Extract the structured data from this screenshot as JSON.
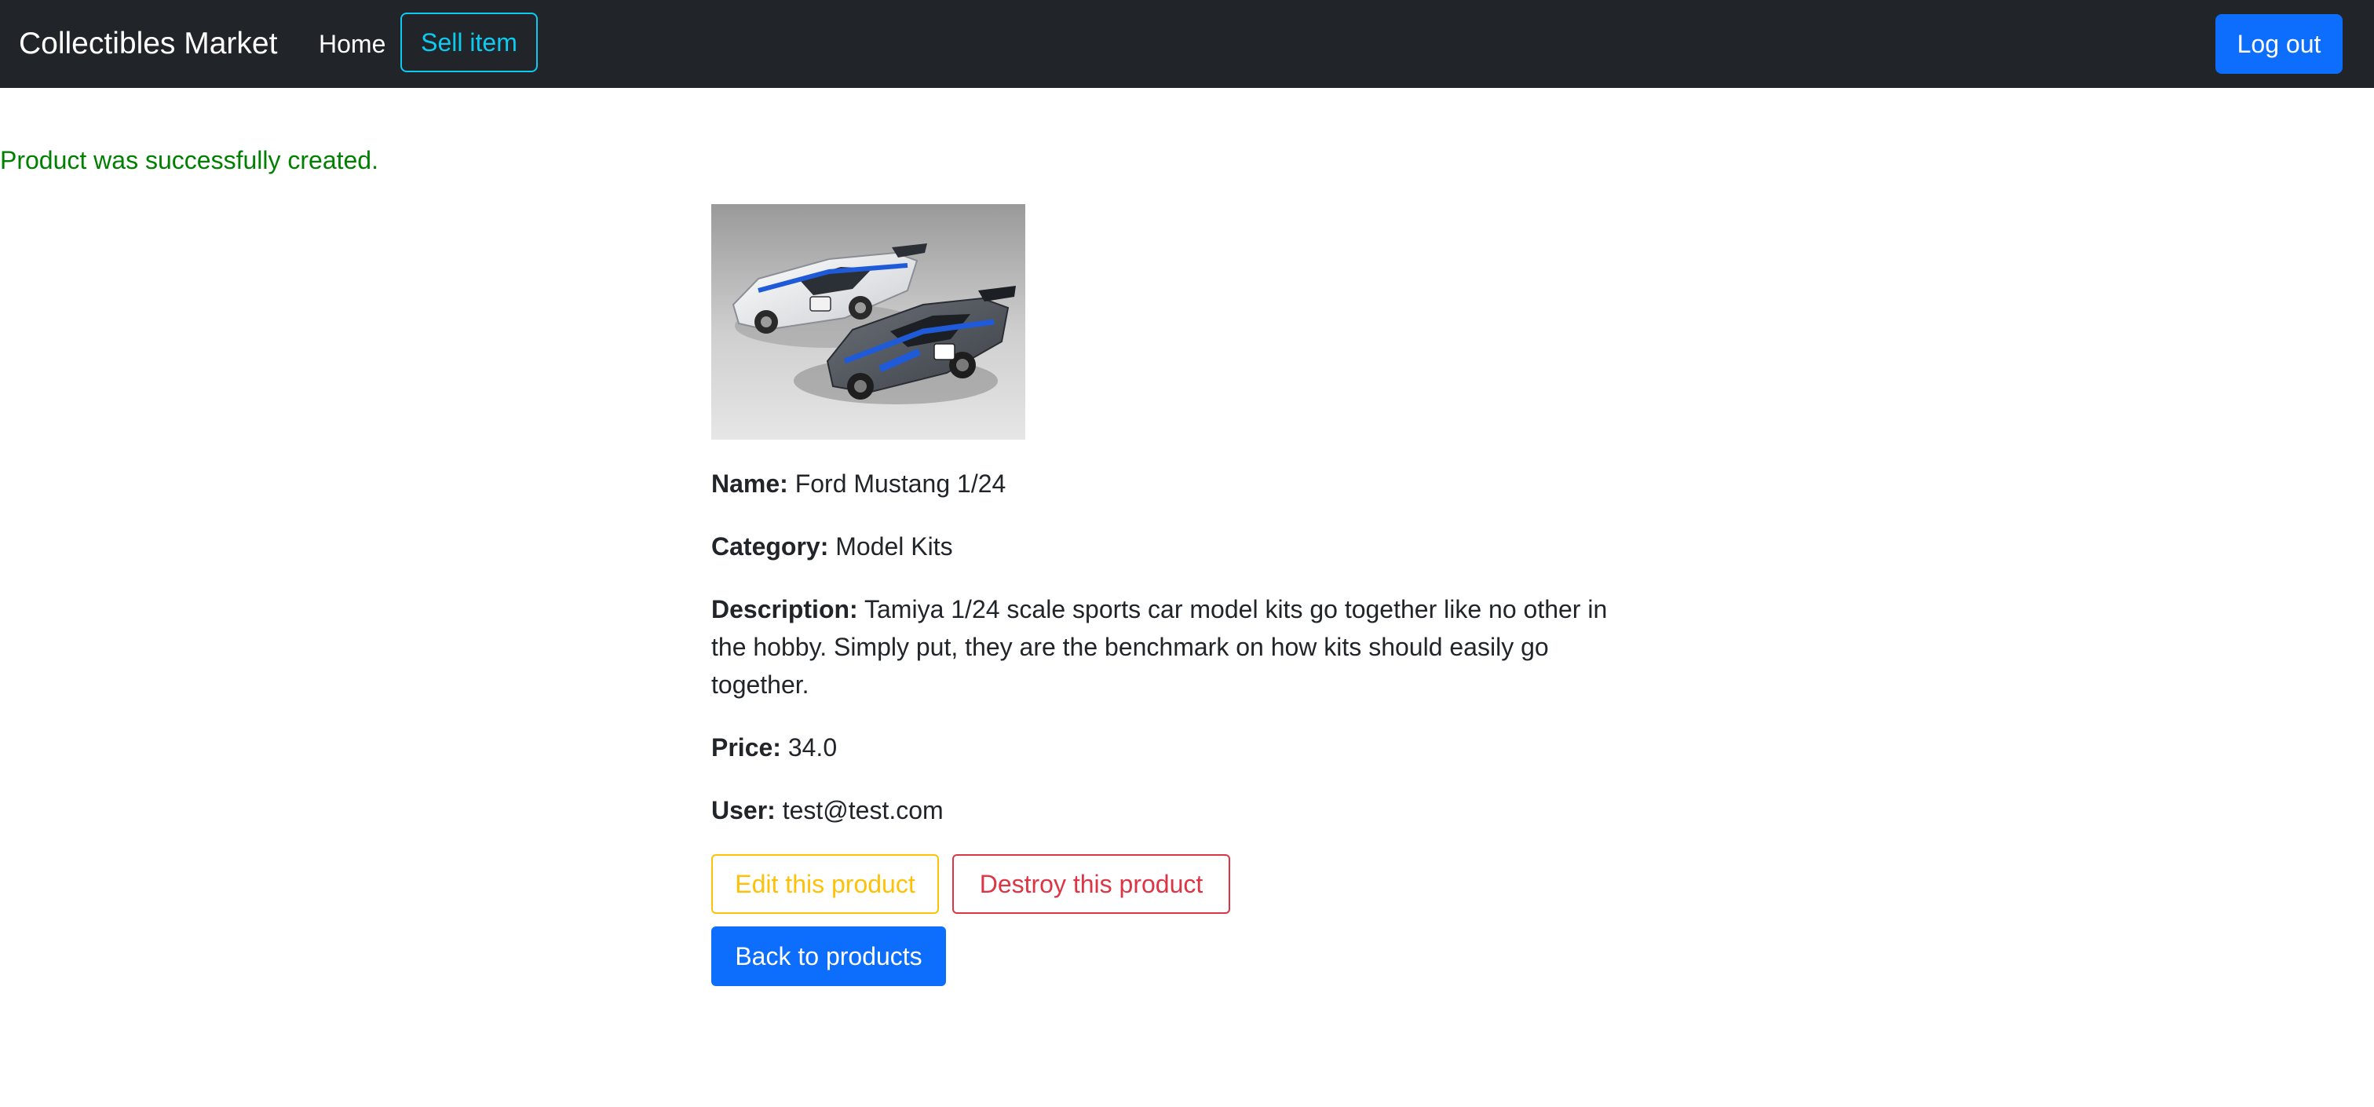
{
  "navbar": {
    "brand": "Collectibles Market",
    "home_label": "Home",
    "sell_label": "Sell item",
    "logout_label": "Log out"
  },
  "notice": "Product was successfully created.",
  "product": {
    "name_label": "Name:",
    "name": "Ford Mustang 1/24",
    "category_label": "Category:",
    "category": "Model Kits",
    "description_label": "Description:",
    "description": "Tamiya 1/24 scale sports car model kits go together like no other in the hobby. Simply put, they are the benchmark on how kits should easily go together.",
    "price_label": "Price:",
    "price": "34.0",
    "user_label": "User:",
    "user": "test@test.com"
  },
  "actions": {
    "edit_label": "Edit this product",
    "destroy_label": "Destroy this product",
    "back_label": "Back to products"
  },
  "colors": {
    "navbar_bg": "#212529",
    "primary": "#0d6efd",
    "info": "#0dcaf0",
    "warning": "#ffc107",
    "danger": "#dc3545",
    "success": "#008000"
  }
}
